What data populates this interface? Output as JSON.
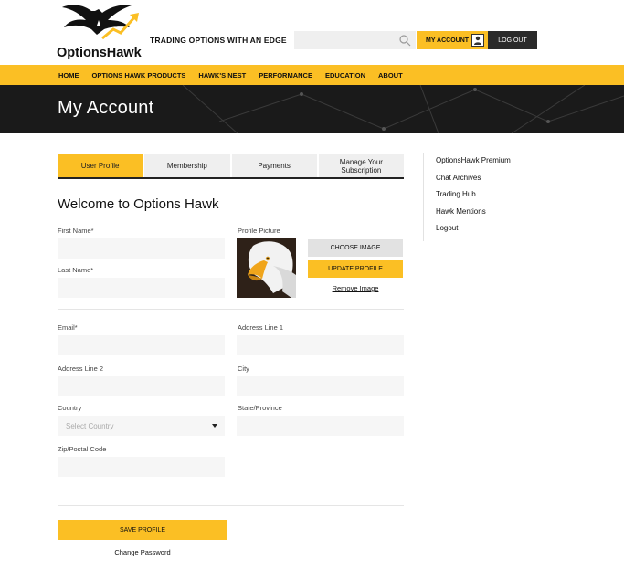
{
  "header": {
    "logo_text": "OptionsHawk",
    "tagline": "TRADING OPTIONS WITH AN EDGE",
    "search_placeholder": "",
    "my_account_label": "MY ACCOUNT",
    "logout_label": "LOG OUT"
  },
  "nav": {
    "items": [
      "HOME",
      "OPTIONS HAWK PRODUCTS",
      "HAWK'S NEST",
      "PERFORMANCE",
      "EDUCATION",
      "ABOUT"
    ]
  },
  "banner": {
    "title": "My Account"
  },
  "tabs": [
    {
      "label": "User Profile",
      "active": true
    },
    {
      "label": "Membership",
      "active": false
    },
    {
      "label": "Payments",
      "active": false
    },
    {
      "label": "Manage Your\nSubscription",
      "active": false
    }
  ],
  "profile": {
    "welcome": "Welcome to Options Hawk",
    "first_name_label": "First Name*",
    "last_name_label": "Last Name*",
    "profile_picture_label": "Profile Picture",
    "choose_image_label": "CHOOSE IMAGE",
    "update_profile_label": "UPDATE PROFILE",
    "remove_image_label": "Remove Image",
    "email_label": "Email*",
    "address1_label": "Address Line 1",
    "address2_label": "Address Line 2",
    "city_label": "City",
    "country_label": "Country",
    "country_placeholder": "Select Country",
    "state_label": "State/Province",
    "zip_label": "Zip/Postal Code",
    "save_label": "SAVE PROFILE",
    "change_password_label": "Change Password"
  },
  "sidebar": {
    "items": [
      "OptionsHawk Premium",
      "Chat Archives",
      "Trading Hub",
      "Hawk Mentions",
      "Logout"
    ]
  },
  "colors": {
    "accent": "#fbbf24",
    "dark": "#1a1a1a"
  }
}
